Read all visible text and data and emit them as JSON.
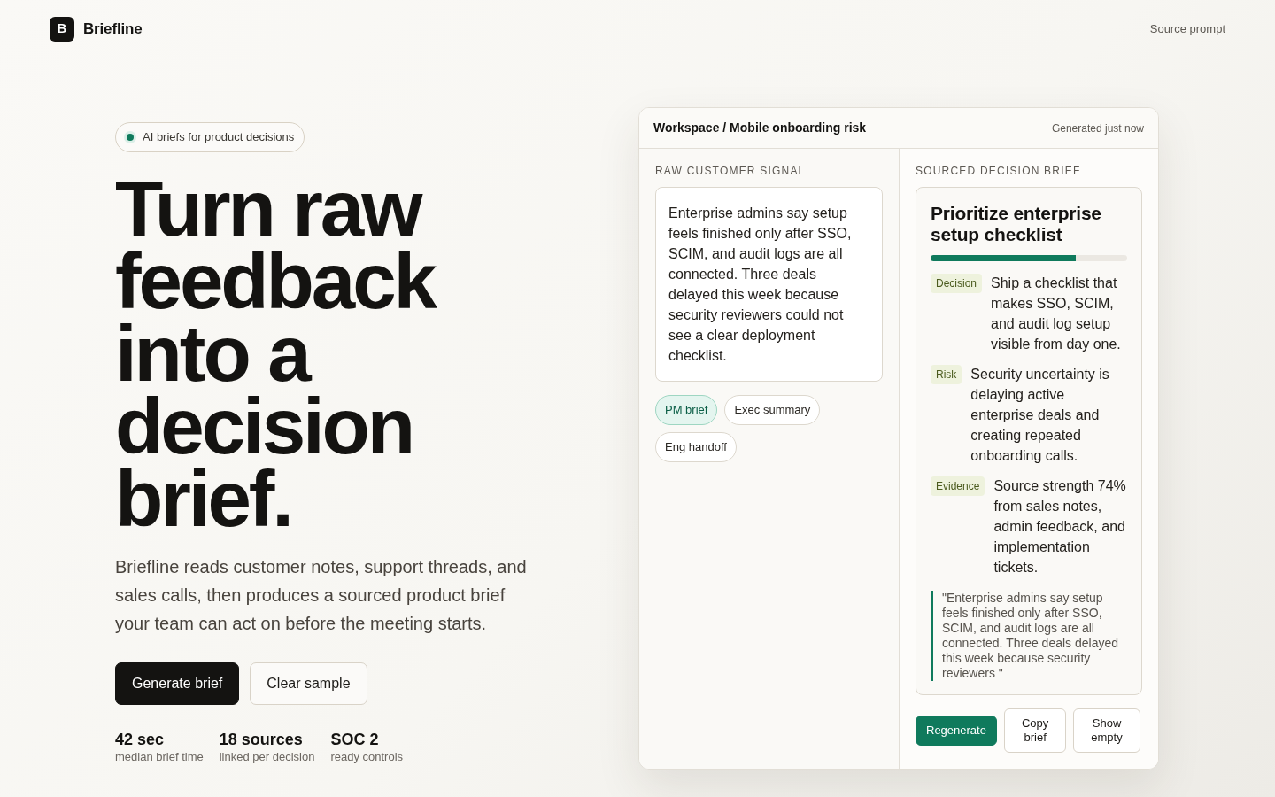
{
  "header": {
    "logo_letter": "B",
    "brand": "Briefline",
    "nav_link": "Source prompt"
  },
  "hero": {
    "badge": "AI briefs for product decisions",
    "headline": "Turn raw feedback into a decision brief.",
    "description": "Briefline reads customer notes, support threads, and sales calls, then produces a sourced product brief your team can act on before the meeting starts.",
    "buttons": [
      {
        "label": "Generate brief",
        "kind": "primary"
      },
      {
        "label": "Clear sample",
        "kind": "secondary"
      }
    ],
    "stats": [
      {
        "value": "42 sec",
        "label": "median brief time"
      },
      {
        "value": "18 sources",
        "label": "linked per decision"
      },
      {
        "value": "SOC 2",
        "label": "ready controls"
      }
    ]
  },
  "workspace": {
    "breadcrumb": "Workspace / Mobile onboarding risk",
    "timestamp": "Generated just now",
    "raw_signal": {
      "heading": "RAW CUSTOMER SIGNAL",
      "text": "Enterprise admins say setup feels finished only after SSO, SCIM, and audit logs are all connected. Three deals delayed this week because security reviewers could not see a clear deployment checklist.",
      "formats": [
        {
          "label": "PM brief",
          "selected": true
        },
        {
          "label": "Exec summary",
          "selected": false
        },
        {
          "label": "Eng handoff",
          "selected": false
        }
      ]
    },
    "brief": {
      "heading": "SOURCED DECISION BRIEF",
      "title": "Prioritize enterprise setup checklist",
      "level": 0.74,
      "items": [
        {
          "tag": "Decision",
          "text": "Ship a checklist that makes SSO, SCIM, and audit log setup visible from day one."
        },
        {
          "tag": "Risk",
          "text": "Security uncertainty is delaying active enterprise deals and creating repeated onboarding calls."
        },
        {
          "tag": "Evidence",
          "text": "Source strength 74% from sales notes, admin feedback, and implementation tickets."
        }
      ],
      "quote": "\"Enterprise admins say setup feels finished only after SSO, SCIM, and audit logs are all connected. Three deals delayed this week because security reviewers \"",
      "actions": [
        {
          "label": "Regenerate",
          "kind": "primary"
        },
        {
          "label": "Copy brief",
          "kind": "secondary"
        },
        {
          "label": "Show empty",
          "kind": "secondary"
        }
      ]
    }
  }
}
